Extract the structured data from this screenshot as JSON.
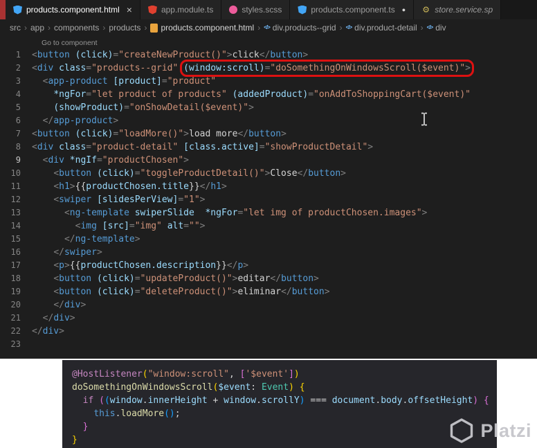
{
  "ui": {
    "close_glyph": "×",
    "modified_glyph": "●"
  },
  "colors": {
    "annotation_red": "#dd1111",
    "editor_bg": "#1e1e1e",
    "panel_bg": "#26262b",
    "accent_strip": "#a83232"
  },
  "tab_bar": {
    "tabs": [
      {
        "label": "products.component.html",
        "icon": {
          "kind": "shield",
          "color": "#42a5f5",
          "name": "angular-component-icon"
        },
        "active": true,
        "closable": true
      },
      {
        "label": "app.module.ts",
        "icon": {
          "kind": "shield",
          "color": "#e0402f",
          "name": "angular-module-icon"
        }
      },
      {
        "label": "styles.scss",
        "icon": {
          "kind": "circle",
          "color": "#ed5c9b",
          "name": "scss-icon"
        }
      },
      {
        "label": "products.component.ts",
        "icon": {
          "kind": "shield",
          "color": "#42a5f5",
          "name": "angular-component-icon"
        },
        "modified": true
      },
      {
        "label": "store.service.sp",
        "icon": {
          "kind": "glyph",
          "char": "⚙",
          "color": "#c9b458",
          "name": "service-icon"
        },
        "preview": true
      }
    ]
  },
  "breadcrumb": {
    "separator": "›",
    "items": [
      {
        "label": "src"
      },
      {
        "label": "app"
      },
      {
        "label": "components"
      },
      {
        "label": "products"
      },
      {
        "label": "products.component.html",
        "icon": {
          "kind": "rect",
          "color": "#e8a33d",
          "name": "file-icon"
        },
        "file": true
      },
      {
        "label": "div.products--grid",
        "icon": {
          "kind": "glyph",
          "char": "</>",
          "color": "#75beff",
          "name": "html-element-icon"
        }
      },
      {
        "label": "div.product-detail",
        "icon": {
          "kind": "glyph",
          "char": "</>",
          "color": "#75beff",
          "name": "html-element-icon"
        }
      },
      {
        "label": "div",
        "icon": {
          "kind": "glyph",
          "char": "</>",
          "color": "#75beff",
          "name": "html-element-icon"
        }
      }
    ]
  },
  "editor": {
    "codelens": "Go to component",
    "lines": [
      {
        "n": 1,
        "tokens": [
          [
            "p",
            "<"
          ],
          [
            "tag",
            "button"
          ],
          [
            "w",
            " "
          ],
          [
            "attr",
            "(click)"
          ],
          [
            "p",
            "="
          ],
          [
            "str",
            "\"createNewProduct()\""
          ],
          [
            "p",
            ">"
          ],
          [
            "txt",
            "click"
          ],
          [
            "p",
            "</"
          ],
          [
            "tag",
            "button"
          ],
          [
            "p",
            ">"
          ]
        ]
      },
      {
        "n": 2,
        "box": {
          "from": 7,
          "to": 10
        },
        "tokens": [
          [
            "p",
            "<"
          ],
          [
            "tag",
            "div"
          ],
          [
            "w",
            " "
          ],
          [
            "attr",
            "class"
          ],
          [
            "p",
            "="
          ],
          [
            "str",
            "\"products--grid\""
          ],
          [
            "w",
            " "
          ],
          [
            "attr",
            "(window:scroll)"
          ],
          [
            "p",
            "="
          ],
          [
            "str",
            "\"doSomethingOnWindowsScroll($event)\""
          ],
          [
            "p",
            ">"
          ]
        ]
      },
      {
        "n": 3,
        "tokens": [
          [
            "w",
            "  "
          ],
          [
            "p",
            "<"
          ],
          [
            "tag",
            "app-product"
          ],
          [
            "w",
            " "
          ],
          [
            "attr",
            "[product]"
          ],
          [
            "p",
            "="
          ],
          [
            "str",
            "\"product\""
          ]
        ]
      },
      {
        "n": 4,
        "tokens": [
          [
            "w",
            "    "
          ],
          [
            "attr",
            "*ngFor"
          ],
          [
            "p",
            "="
          ],
          [
            "str",
            "\"let product of products\""
          ],
          [
            "w",
            " "
          ],
          [
            "attr",
            "(addedProduct)"
          ],
          [
            "p",
            "="
          ],
          [
            "str",
            "\"onAddToShoppingCart($event)\""
          ]
        ]
      },
      {
        "n": 5,
        "tokens": [
          [
            "w",
            "    "
          ],
          [
            "attr",
            "(showProduct)"
          ],
          [
            "p",
            "="
          ],
          [
            "str",
            "\"onShowDetail($event)\""
          ],
          [
            "p",
            ">"
          ]
        ]
      },
      {
        "n": 6,
        "tokens": [
          [
            "w",
            "  "
          ],
          [
            "p",
            "</"
          ],
          [
            "tag",
            "app-product"
          ],
          [
            "p",
            ">"
          ]
        ]
      },
      {
        "n": 7,
        "tokens": [
          [
            "p",
            "<"
          ],
          [
            "tag",
            "button"
          ],
          [
            "w",
            " "
          ],
          [
            "attr",
            "(click)"
          ],
          [
            "p",
            "="
          ],
          [
            "str",
            "\"loadMore()\""
          ],
          [
            "p",
            ">"
          ],
          [
            "txt",
            "load more"
          ],
          [
            "p",
            "</"
          ],
          [
            "tag",
            "button"
          ],
          [
            "p",
            ">"
          ]
        ]
      },
      {
        "n": 8,
        "tokens": [
          [
            "p",
            "<"
          ],
          [
            "tag",
            "div"
          ],
          [
            "w",
            " "
          ],
          [
            "attr",
            "class"
          ],
          [
            "p",
            "="
          ],
          [
            "str",
            "\"product-detail\""
          ],
          [
            "w",
            " "
          ],
          [
            "attr",
            "[class.active]"
          ],
          [
            "p",
            "="
          ],
          [
            "str",
            "\"showProductDetail\""
          ],
          [
            "p",
            ">"
          ]
        ]
      },
      {
        "n": 9,
        "active": true,
        "tokens": [
          [
            "w",
            "  "
          ],
          [
            "p",
            "<"
          ],
          [
            "tag",
            "div"
          ],
          [
            "w",
            " "
          ],
          [
            "attr",
            "*ngIf"
          ],
          [
            "p",
            "="
          ],
          [
            "str",
            "\"productChosen\""
          ],
          [
            "p",
            ">"
          ]
        ]
      },
      {
        "n": 10,
        "tokens": [
          [
            "w",
            "    "
          ],
          [
            "p",
            "<"
          ],
          [
            "tag",
            "button"
          ],
          [
            "w",
            " "
          ],
          [
            "attr",
            "(click)"
          ],
          [
            "p",
            "="
          ],
          [
            "str",
            "\"toggleProductDetail()\""
          ],
          [
            "p",
            ">"
          ],
          [
            "txt",
            "Close"
          ],
          [
            "p",
            "</"
          ],
          [
            "tag",
            "button"
          ],
          [
            "p",
            ">"
          ]
        ]
      },
      {
        "n": 11,
        "tokens": [
          [
            "w",
            "    "
          ],
          [
            "p",
            "<"
          ],
          [
            "tag",
            "h1"
          ],
          [
            "p",
            ">"
          ],
          [
            "txt",
            "{{"
          ],
          [
            "attr",
            "productChosen.title"
          ],
          [
            "txt",
            "}}"
          ],
          [
            "p",
            "</"
          ],
          [
            "tag",
            "h1"
          ],
          [
            "p",
            ">"
          ]
        ]
      },
      {
        "n": 12,
        "tokens": [
          [
            "w",
            "    "
          ],
          [
            "p",
            "<"
          ],
          [
            "tag",
            "swiper"
          ],
          [
            "w",
            " "
          ],
          [
            "attr",
            "[slidesPerView]"
          ],
          [
            "p",
            "="
          ],
          [
            "str",
            "\"1\""
          ],
          [
            "p",
            ">"
          ]
        ]
      },
      {
        "n": 13,
        "tokens": [
          [
            "w",
            "      "
          ],
          [
            "p",
            "<"
          ],
          [
            "tag",
            "ng-template"
          ],
          [
            "w",
            " "
          ],
          [
            "attr",
            "swiperSlide"
          ],
          [
            "w",
            "  "
          ],
          [
            "attr",
            "*ngFor"
          ],
          [
            "p",
            "="
          ],
          [
            "str",
            "\"let img of productChosen.images\""
          ],
          [
            "p",
            ">"
          ]
        ]
      },
      {
        "n": 14,
        "tokens": [
          [
            "w",
            "        "
          ],
          [
            "p",
            "<"
          ],
          [
            "tag",
            "img"
          ],
          [
            "w",
            " "
          ],
          [
            "attr",
            "[src]"
          ],
          [
            "p",
            "="
          ],
          [
            "str",
            "\"img\""
          ],
          [
            "w",
            " "
          ],
          [
            "attr",
            "alt"
          ],
          [
            "p",
            "="
          ],
          [
            "str",
            "\"\""
          ],
          [
            "p",
            ">"
          ]
        ]
      },
      {
        "n": 15,
        "tokens": [
          [
            "w",
            "      "
          ],
          [
            "p",
            "</"
          ],
          [
            "tag",
            "ng-template"
          ],
          [
            "p",
            ">"
          ]
        ]
      },
      {
        "n": 16,
        "tokens": [
          [
            "w",
            "    "
          ],
          [
            "p",
            "</"
          ],
          [
            "tag",
            "swiper"
          ],
          [
            "p",
            ">"
          ]
        ]
      },
      {
        "n": 17,
        "tokens": [
          [
            "w",
            "    "
          ],
          [
            "p",
            "<"
          ],
          [
            "tag",
            "p"
          ],
          [
            "p",
            ">"
          ],
          [
            "txt",
            "{{"
          ],
          [
            "attr",
            "productChosen.description"
          ],
          [
            "txt",
            "}}"
          ],
          [
            "p",
            "</"
          ],
          [
            "tag",
            "p"
          ],
          [
            "p",
            ">"
          ]
        ]
      },
      {
        "n": 18,
        "tokens": [
          [
            "w",
            "    "
          ],
          [
            "p",
            "<"
          ],
          [
            "tag",
            "button"
          ],
          [
            "w",
            " "
          ],
          [
            "attr",
            "(click)"
          ],
          [
            "p",
            "="
          ],
          [
            "str",
            "\"updateProduct()\""
          ],
          [
            "p",
            ">"
          ],
          [
            "txt",
            "editar"
          ],
          [
            "p",
            "</"
          ],
          [
            "tag",
            "button"
          ],
          [
            "p",
            ">"
          ]
        ]
      },
      {
        "n": 19,
        "tokens": [
          [
            "w",
            "    "
          ],
          [
            "p",
            "<"
          ],
          [
            "tag",
            "button"
          ],
          [
            "w",
            " "
          ],
          [
            "attr",
            "(click)"
          ],
          [
            "p",
            "="
          ],
          [
            "str",
            "\"deleteProduct()\""
          ],
          [
            "p",
            ">"
          ],
          [
            "txt",
            "eliminar"
          ],
          [
            "p",
            "</"
          ],
          [
            "tag",
            "button"
          ],
          [
            "p",
            ">"
          ]
        ]
      },
      {
        "n": 20,
        "tokens": [
          [
            "w",
            "    "
          ],
          [
            "p",
            "</"
          ],
          [
            "tag",
            "div"
          ],
          [
            "p",
            ">"
          ]
        ]
      },
      {
        "n": 21,
        "tokens": [
          [
            "w",
            "  "
          ],
          [
            "p",
            "</"
          ],
          [
            "tag",
            "div"
          ],
          [
            "p",
            ">"
          ]
        ]
      },
      {
        "n": 22,
        "tokens": [
          [
            "p",
            "</"
          ],
          [
            "tag",
            "div"
          ],
          [
            "p",
            ">"
          ]
        ]
      },
      {
        "n": 23,
        "tokens": []
      }
    ]
  },
  "snippet": {
    "lines": [
      [
        [
          "dec",
          "@HostListener"
        ],
        [
          "b1",
          "("
        ],
        [
          "str",
          "\"window:scroll\""
        ],
        [
          "pun",
          ", "
        ],
        [
          "b2",
          "["
        ],
        [
          "str",
          "'$event'"
        ],
        [
          "b2",
          "]"
        ],
        [
          "b1",
          ")"
        ]
      ],
      [
        [
          "fn",
          "doSomethingOnWindowsScroll"
        ],
        [
          "b1",
          "("
        ],
        [
          "var",
          "$event"
        ],
        [
          "pun",
          ": "
        ],
        [
          "type",
          "Event"
        ],
        [
          "b1",
          ")"
        ],
        [
          "pun",
          " "
        ],
        [
          "b1",
          "{"
        ]
      ],
      [
        [
          "w",
          "  "
        ],
        [
          "kw",
          "if"
        ],
        [
          "w",
          " "
        ],
        [
          "b2",
          "("
        ],
        [
          "b3",
          "("
        ],
        [
          "var",
          "window"
        ],
        [
          "pun",
          "."
        ],
        [
          "var",
          "innerHeight"
        ],
        [
          "pun",
          " + "
        ],
        [
          "var",
          "window"
        ],
        [
          "pun",
          "."
        ],
        [
          "var",
          "scrollY"
        ],
        [
          "b3",
          ")"
        ],
        [
          "pun",
          " === "
        ],
        [
          "var",
          "document"
        ],
        [
          "pun",
          "."
        ],
        [
          "var",
          "body"
        ],
        [
          "pun",
          "."
        ],
        [
          "var",
          "offsetHeight"
        ],
        [
          "b2",
          ")"
        ],
        [
          "pun",
          " "
        ],
        [
          "b2",
          "{"
        ]
      ],
      [
        [
          "w",
          "    "
        ],
        [
          "kw2",
          "this"
        ],
        [
          "pun",
          "."
        ],
        [
          "fn",
          "loadMore"
        ],
        [
          "b3",
          "()"
        ],
        [
          "pun",
          ";"
        ]
      ],
      [
        [
          "w",
          "  "
        ],
        [
          "b2",
          "}"
        ]
      ],
      [
        [
          "b1",
          "}"
        ]
      ]
    ]
  },
  "watermark": {
    "text": "Platzi"
  }
}
